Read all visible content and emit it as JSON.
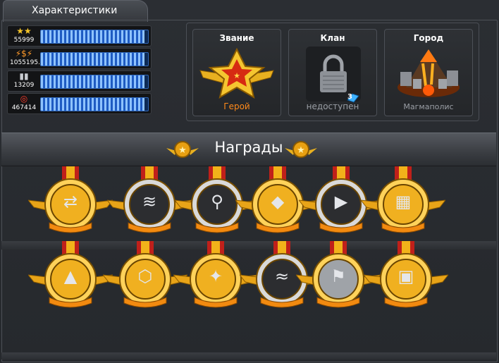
{
  "panel": {
    "tab_title": "Характеристики"
  },
  "stats": [
    {
      "icon": "stars-icon",
      "value": "55999",
      "fill": 0.97
    },
    {
      "icon": "money-lightning-icon",
      "value": "1055195...",
      "fill": 0.97
    },
    {
      "icon": "steel-bars-icon",
      "value": "13209",
      "fill": 0.97
    },
    {
      "icon": "target-icon",
      "value": "467414",
      "fill": 0.97
    }
  ],
  "rank": {
    "title": "Звание",
    "name": "Герой"
  },
  "clan": {
    "title": "Клан",
    "status": "недоступен",
    "badge_count": "3"
  },
  "city": {
    "title": "Город",
    "name": "Магмаполис"
  },
  "awards": {
    "title": "Награды",
    "medals": [
      {
        "icon": "arrows-swap-icon",
        "tier": "gold"
      },
      {
        "icon": "chevron-stack-icon",
        "tier": "dark"
      },
      {
        "icon": "magnifier-icon",
        "tier": "dark"
      },
      {
        "icon": "diamond-star-icon",
        "tier": "gold"
      },
      {
        "icon": "bullet-icon",
        "tier": "dark"
      },
      {
        "icon": "blocks-icon",
        "tier": "gold"
      },
      {
        "icon": "tower-icon",
        "tier": "gold"
      },
      {
        "icon": "hexagon-tower-icon",
        "tier": "gold"
      },
      {
        "icon": "dove-icon",
        "tier": "gold"
      },
      {
        "icon": "wings-emblem-icon",
        "tier": "dark"
      },
      {
        "icon": "flag-icon",
        "tier": "silver"
      },
      {
        "icon": "square-frame-icon",
        "tier": "gold"
      }
    ]
  },
  "colors": {
    "bar_blue": "#2f66b8",
    "rank_name": "#ff8a1a",
    "muted": "#9a9ea5",
    "gold": "#f2b21a"
  }
}
